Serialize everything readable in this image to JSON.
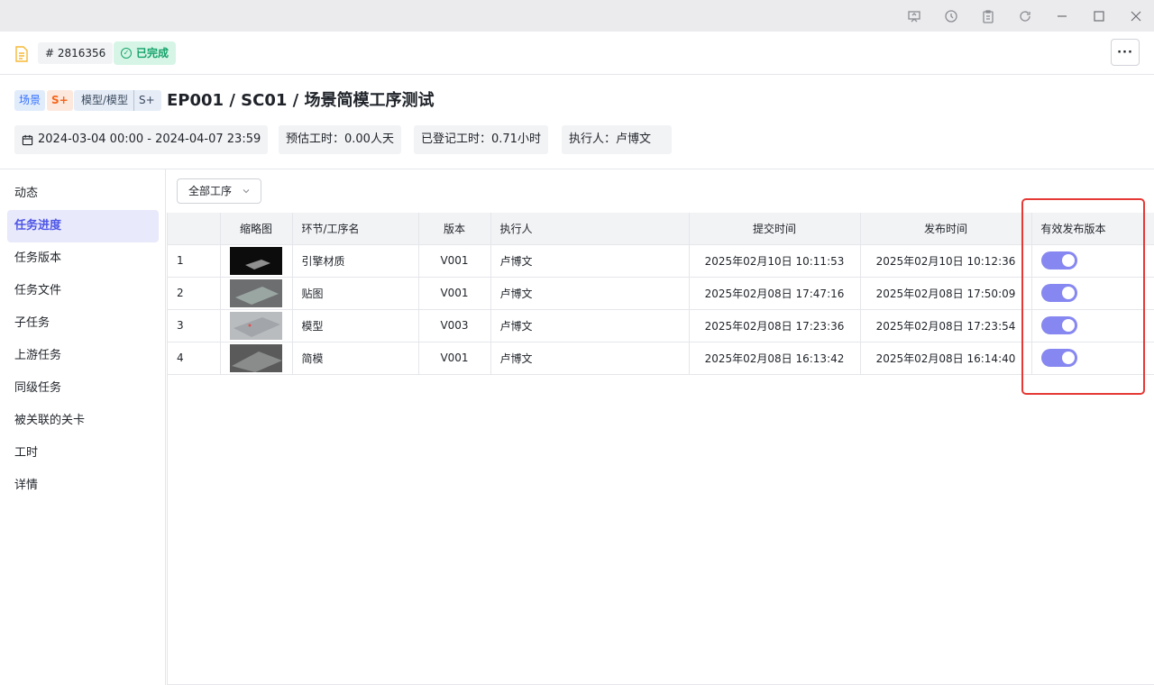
{
  "header": {
    "id_text": "# 2816356",
    "status": "已完成",
    "more_label": "···"
  },
  "title": {
    "tag_scene": "场景",
    "tag_grade1": "S+",
    "tag_model_a": "模型/模型",
    "tag_model_b": "S+",
    "text": "EP001 / SC01 / 场景简模工序测试"
  },
  "meta": {
    "date_range": "2024-03-04 00:00 - 2024-04-07 23:59",
    "estimated": "预估工时：0.00人天",
    "logged": "已登记工时：0.71小时",
    "executor": "执行人：卢博文"
  },
  "sidebar": {
    "items": [
      {
        "label": "动态"
      },
      {
        "label": "任务进度"
      },
      {
        "label": "任务版本"
      },
      {
        "label": "任务文件"
      },
      {
        "label": "子任务"
      },
      {
        "label": "上游任务"
      },
      {
        "label": "同级任务"
      },
      {
        "label": "被关联的关卡"
      },
      {
        "label": "工时"
      },
      {
        "label": "详情"
      }
    ],
    "active_index": 1
  },
  "filter": {
    "label": "全部工序"
  },
  "table": {
    "columns": [
      "",
      "缩略图",
      "环节/工序名",
      "版本",
      "执行人",
      "提交时间",
      "发布时间",
      "有效发布版本"
    ],
    "rows": [
      {
        "no": "1",
        "name": "引擎材质",
        "version": "V001",
        "executor": "卢博文",
        "submit": "2025年02月10日 10:11:53",
        "publish": "2025年02月10日 10:12:36",
        "valid": true
      },
      {
        "no": "2",
        "name": "贴图",
        "version": "V001",
        "executor": "卢博文",
        "submit": "2025年02月08日 17:47:16",
        "publish": "2025年02月08日 17:50:09",
        "valid": true
      },
      {
        "no": "3",
        "name": "模型",
        "version": "V003",
        "executor": "卢博文",
        "submit": "2025年02月08日 17:23:36",
        "publish": "2025年02月08日 17:23:54",
        "valid": true
      },
      {
        "no": "4",
        "name": "简模",
        "version": "V001",
        "executor": "卢博文",
        "submit": "2025年02月08日 16:13:42",
        "publish": "2025年02月08日 16:14:40",
        "valid": true
      }
    ]
  },
  "colors": {
    "accent": "#4e56e6",
    "toggle_on": "#8687f0",
    "status_green": "#15a36a",
    "highlight_red": "#e53935"
  }
}
